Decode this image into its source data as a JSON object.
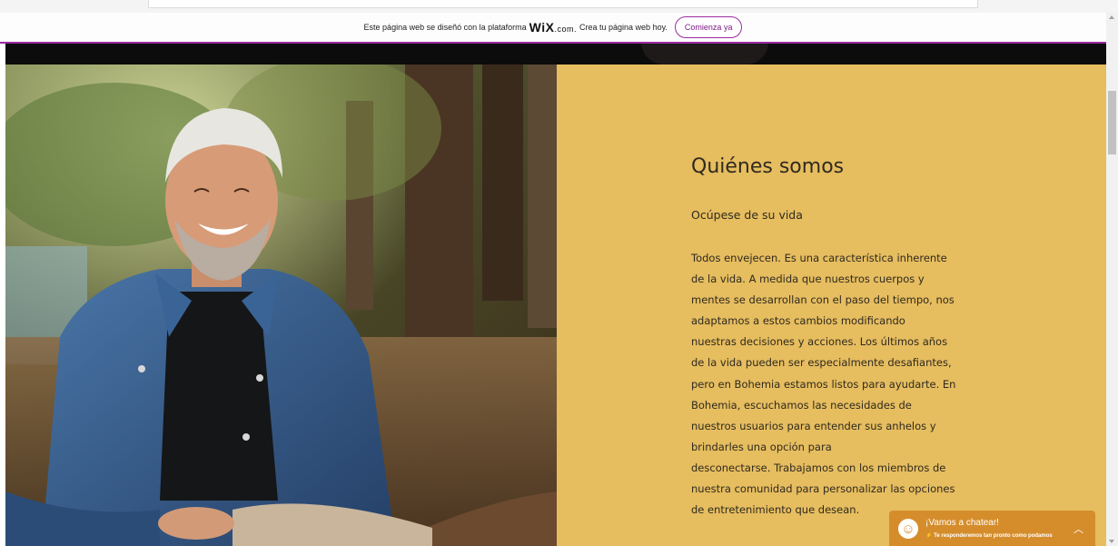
{
  "wix_banner": {
    "text": "Este página web se diseñó con la plataforma",
    "brand": "WiX",
    "brand_suffix": ".com.",
    "text_after": "Crea tu página web hoy.",
    "cta_label": "Comienza ya"
  },
  "about": {
    "title": "Quiénes somos",
    "subtitle": "Ocúpese de su vida",
    "body_lines": [
      "Todos envejecen.  Es una característica inherente",
      "de la vida.  A medida que nuestros cuerpos y",
      "mentes se desarrollan con el paso del tiempo, nos",
      "adaptamos a estos cambios modificando",
      "nuestras decisiones y acciones.  Los últimos años",
      "de la vida pueden ser especialmente desafiantes,",
      "pero en Bohemia estamos listos para ayudarte.  En",
      "Bohemia, escuchamos las necesidades de",
      "nuestros usuarios para entender sus anhelos y",
      "brindarles una opción para",
      "desconectarse.  Trabajamos con los miembros de",
      "nuestra comunidad para personalizar las opciones",
      "de entretenimiento que desean."
    ]
  },
  "chat": {
    "title": "¡Vamos a chatear!",
    "subtitle": "Te responderemos tan pronto como podamos"
  },
  "colors": {
    "accent": "#9b2ca0",
    "section_bg": "#e6bd5f",
    "chat_bg": "#d58d2c"
  },
  "icons": {
    "chat_avatar": "smiley-icon",
    "chat_expand": "chevron-up-icon",
    "chat_bolt": "lightning-icon"
  }
}
